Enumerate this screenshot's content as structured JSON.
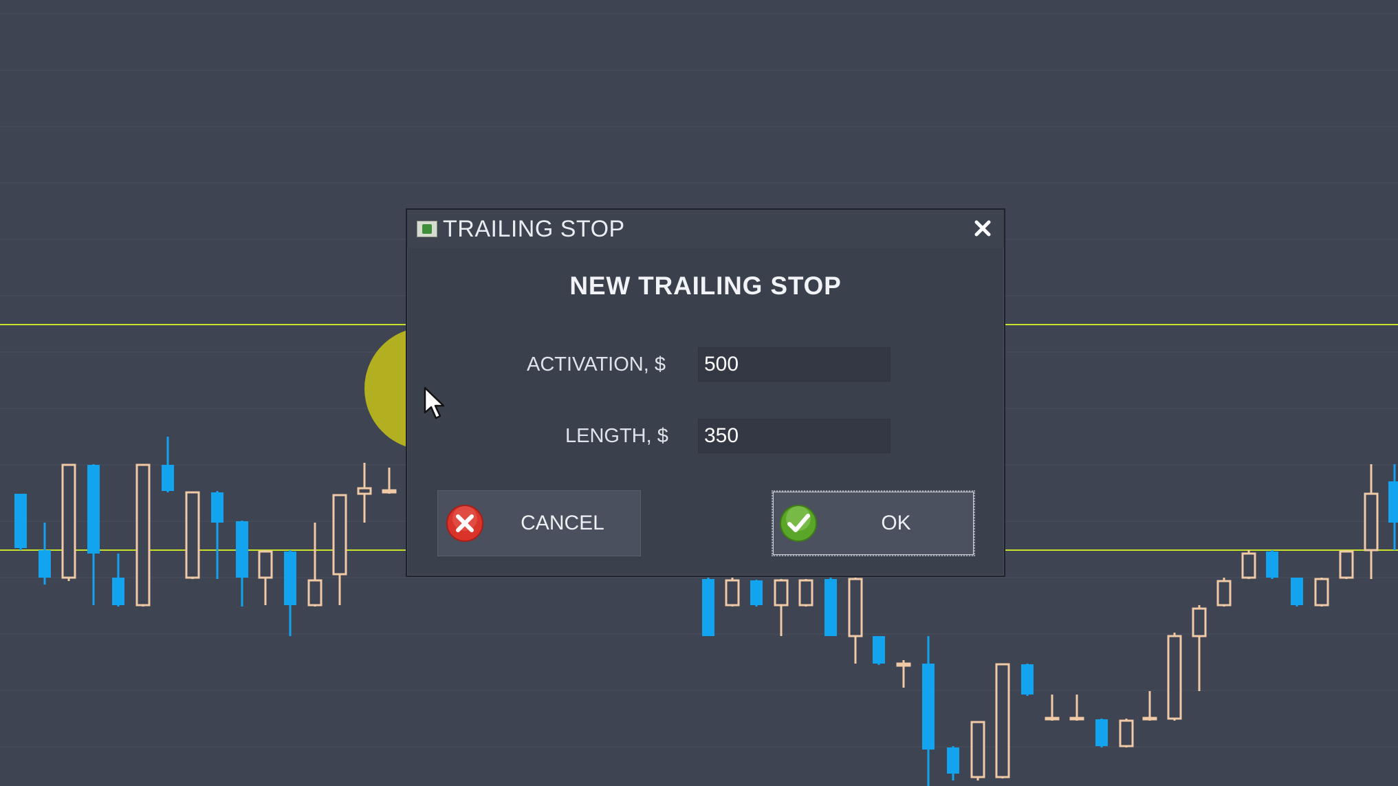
{
  "dialog": {
    "title": "TRAILING STOP",
    "heading": "NEW TRAILING STOP",
    "fields": [
      {
        "label": "ACTIVATION, $",
        "value": "500"
      },
      {
        "label": "LENGTH, $",
        "value": "350"
      }
    ],
    "buttons": {
      "cancel_label": "CANCEL",
      "ok_label": "OK"
    }
  },
  "icons": {
    "app": "app-window-icon",
    "close": "close-icon",
    "cancel": "red-x-circle-icon",
    "ok": "green-check-circle-icon",
    "cursor": "mouse-pointer-icon"
  },
  "colors": {
    "background": "#3f4452",
    "grid_line": "#4a4f5d",
    "up_candle": "#f0c9a7",
    "down_candle": "#12a4ee",
    "level_line": "#c9e02a",
    "cursor_highlight": "#b8b51f",
    "cancel_icon": "#d9332a",
    "ok_icon": "#5aa628"
  }
}
